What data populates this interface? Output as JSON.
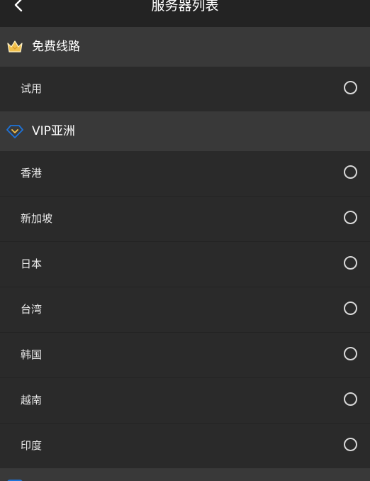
{
  "header": {
    "title": "服务器列表"
  },
  "sections": [
    {
      "title": "免费线路",
      "icon": "crown-icon",
      "items": [
        {
          "label": "试用",
          "selected": false
        }
      ]
    },
    {
      "title": "VIP亚洲",
      "icon": "diamond-icon",
      "items": [
        {
          "label": "香港",
          "selected": false
        },
        {
          "label": "新加坡",
          "selected": false
        },
        {
          "label": "日本",
          "selected": false
        },
        {
          "label": "台湾",
          "selected": false
        },
        {
          "label": "韩国",
          "selected": false
        },
        {
          "label": "越南",
          "selected": false
        },
        {
          "label": "印度",
          "selected": false
        }
      ]
    }
  ],
  "colors": {
    "background": "#2a2a2a",
    "header": "#232323",
    "section_header": "#393939",
    "crown": "#f2c14e",
    "diamond": "#1e73d8"
  }
}
